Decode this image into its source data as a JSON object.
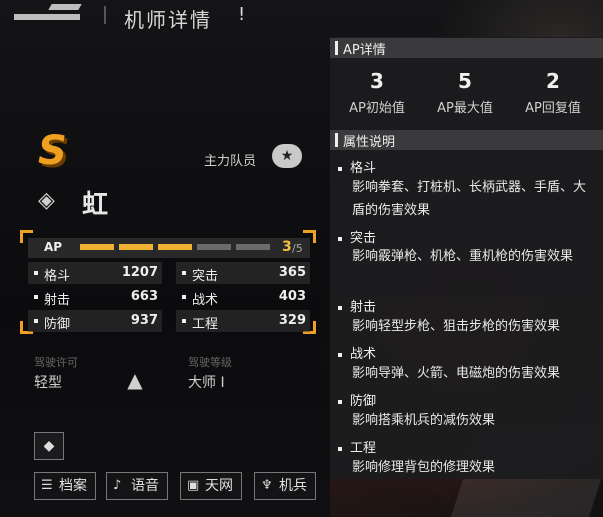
{
  "header": {
    "title": "机师详情",
    "mark": "!"
  },
  "pilot": {
    "rank": "S",
    "squad_label": "主力队员",
    "squad_icon": "star-badge-icon",
    "name": "虹",
    "license_label": "驾驶许可",
    "license_value": "轻型",
    "level_label": "驾驶等级",
    "level_value": "大师 I"
  },
  "stats": {
    "ap_label": "AP",
    "ap_value": "3",
    "ap_max": "/5",
    "ap_filled": 3,
    "ap_total": 5,
    "items": [
      {
        "label": "格斗",
        "value": "1207"
      },
      {
        "label": "突击",
        "value": "365"
      },
      {
        "label": "射击",
        "value": "663"
      },
      {
        "label": "战术",
        "value": "403"
      },
      {
        "label": "防御",
        "value": "937"
      },
      {
        "label": "工程",
        "value": "329"
      }
    ]
  },
  "buttons": {
    "archive": "档案",
    "voice": "语音",
    "sky": "天网",
    "mech": "机兵"
  },
  "ap_detail": {
    "title": "AP详情",
    "cols": [
      {
        "value": "3",
        "caption": "AP初始值"
      },
      {
        "value": "5",
        "caption": "AP最大值"
      },
      {
        "value": "2",
        "caption": "AP回复值"
      }
    ]
  },
  "attributes": {
    "title": "属性说明",
    "items": [
      {
        "name": "格斗",
        "desc": "影响拳套、打桩机、长柄武器、手盾、大盾的伤害效果"
      },
      {
        "name": "突击",
        "desc": "影响霰弹枪、机枪、重机枪的伤害效果"
      },
      {
        "name": "射击",
        "desc": "影响轻型步枪、狙击步枪的伤害效果"
      },
      {
        "name": "战术",
        "desc": "影响导弹、火箭、电磁炮的伤害效果"
      },
      {
        "name": "防御",
        "desc": "影响搭乘机兵的减伤效果"
      },
      {
        "name": "工程",
        "desc": "影响修理背包的修理效果"
      }
    ]
  },
  "colors": {
    "accent": "#f0a020",
    "ap_bar_on": "#f0b030",
    "ap_bar_off": "#6b6b6b"
  }
}
